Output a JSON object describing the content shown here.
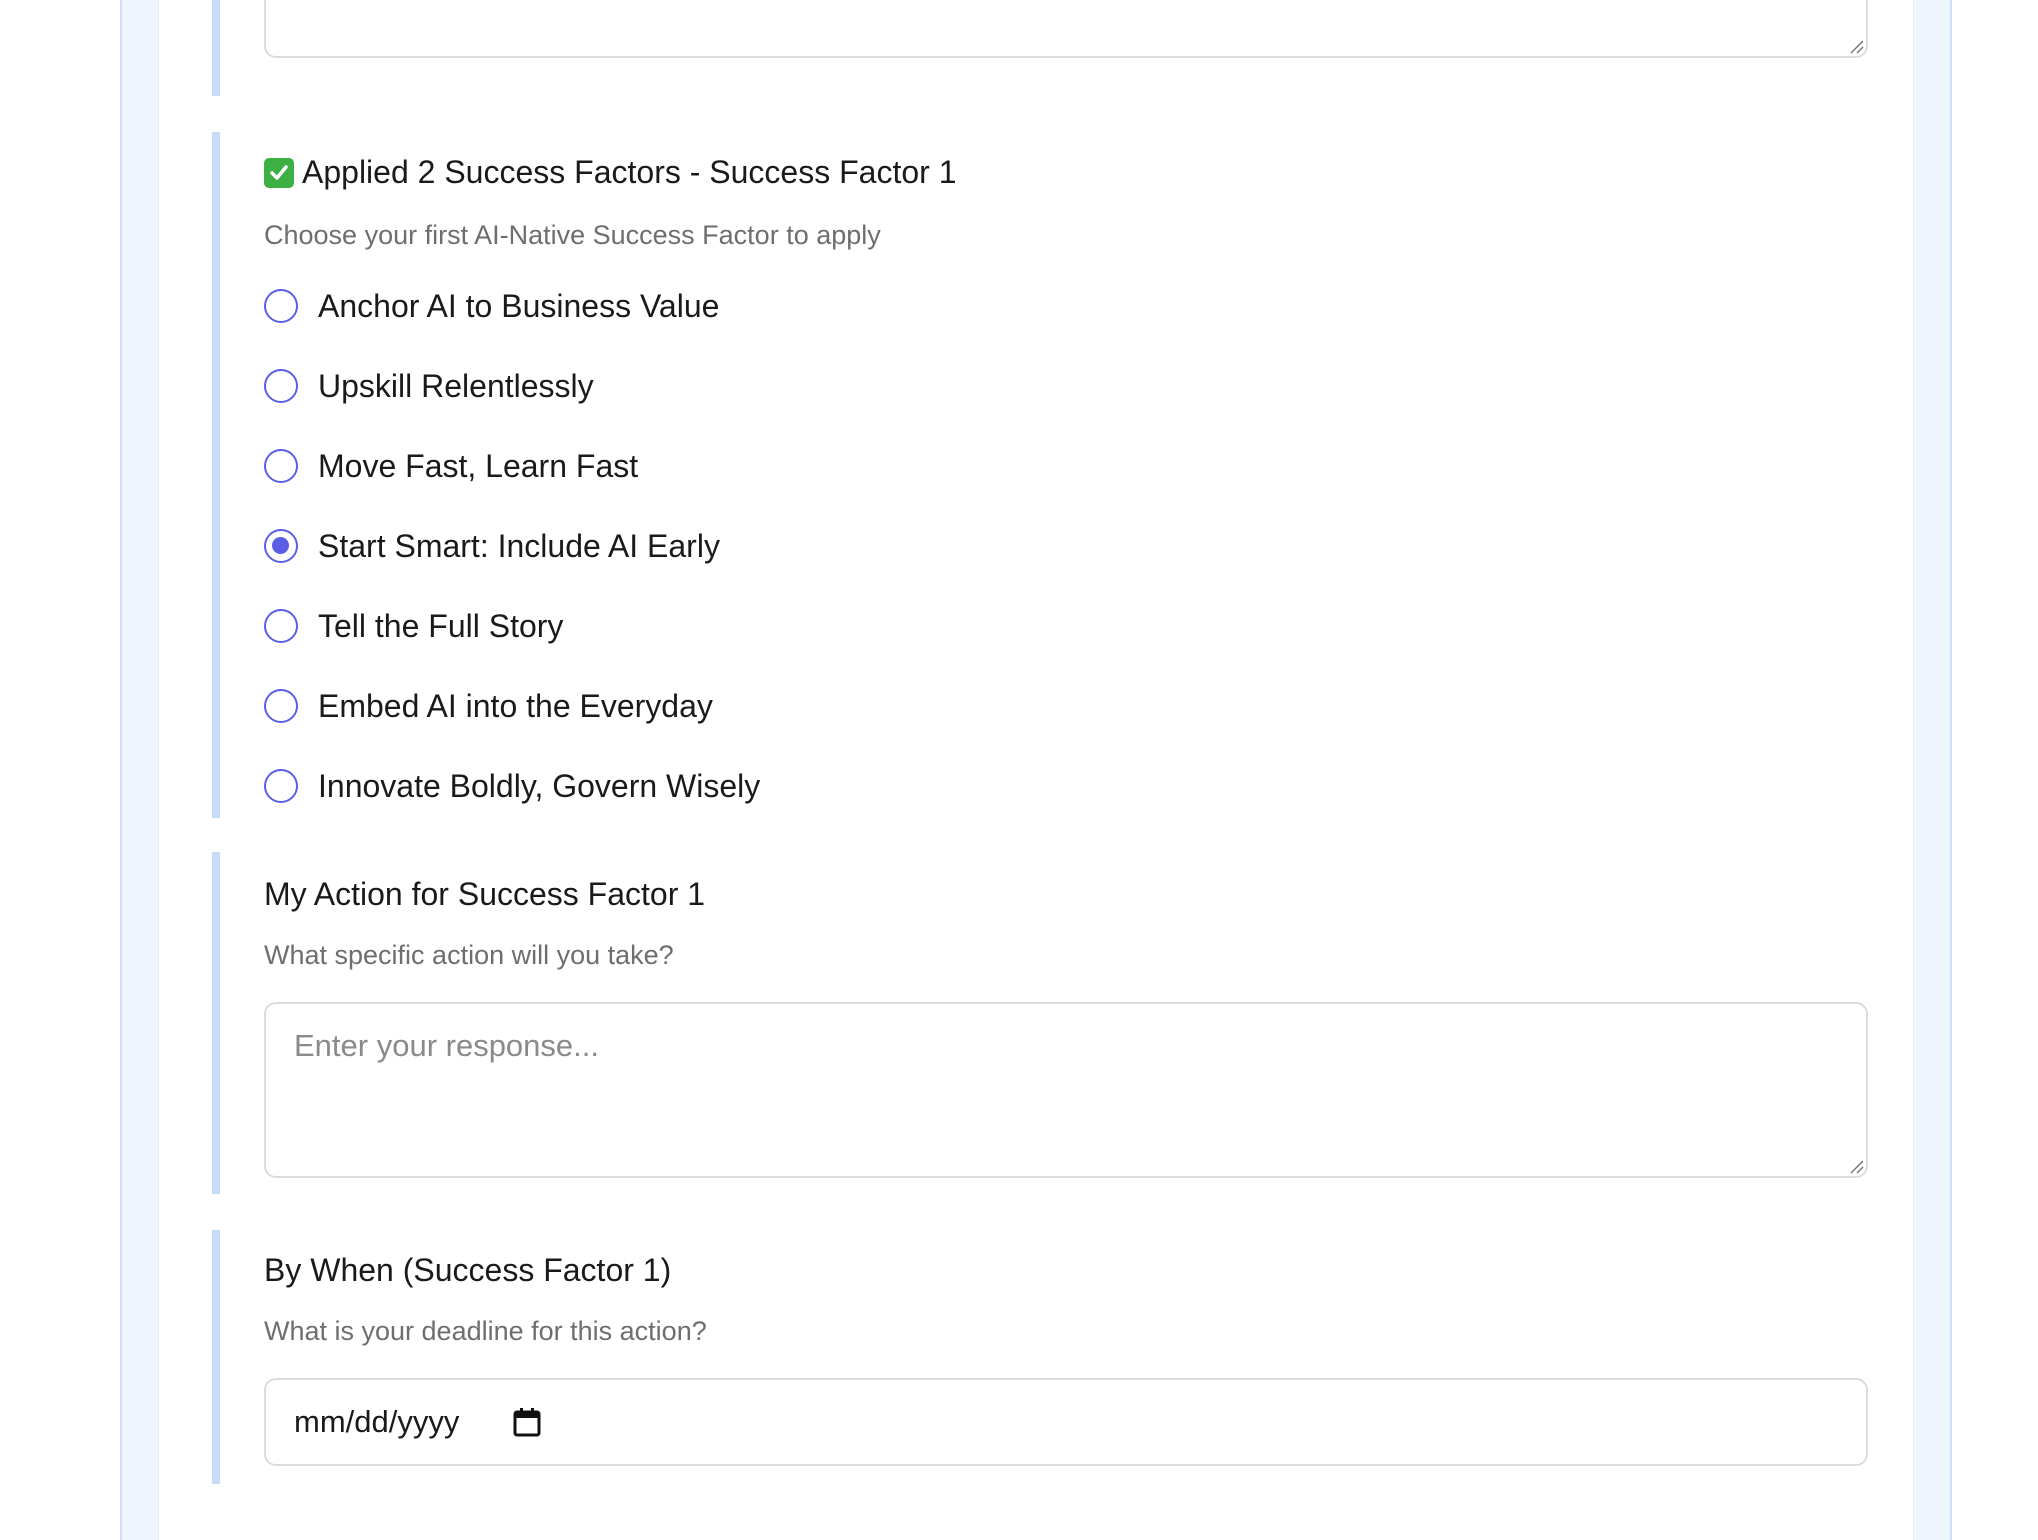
{
  "previous_section": {
    "textarea_value": ""
  },
  "factor_section": {
    "check_icon": "check-mark-icon",
    "title": "Applied 2 Success Factors - Success Factor 1",
    "subtitle": "Choose your first AI-Native Success Factor to apply",
    "options": [
      {
        "label": "Anchor AI to Business Value",
        "selected": false
      },
      {
        "label": "Upskill Relentlessly",
        "selected": false
      },
      {
        "label": "Move Fast, Learn Fast",
        "selected": false
      },
      {
        "label": "Start Smart: Include AI Early",
        "selected": true
      },
      {
        "label": "Tell the Full Story",
        "selected": false
      },
      {
        "label": "Embed AI into the Everyday",
        "selected": false
      },
      {
        "label": "Innovate Boldly, Govern Wisely",
        "selected": false
      }
    ]
  },
  "action_section": {
    "title": "My Action for Success Factor 1",
    "subtitle": "What specific action will you take?",
    "placeholder": "Enter your response..."
  },
  "when_section": {
    "title": "By When (Success Factor 1)",
    "subtitle": "What is your deadline for this action?",
    "date_placeholder": "mm/dd/yyyy",
    "calendar_icon": "calendar-icon"
  },
  "colors": {
    "accent": "#5b5fe6",
    "section_bar": "#c8dbf6",
    "panel_bg": "#eef5fd",
    "check_green": "#3cb043"
  }
}
